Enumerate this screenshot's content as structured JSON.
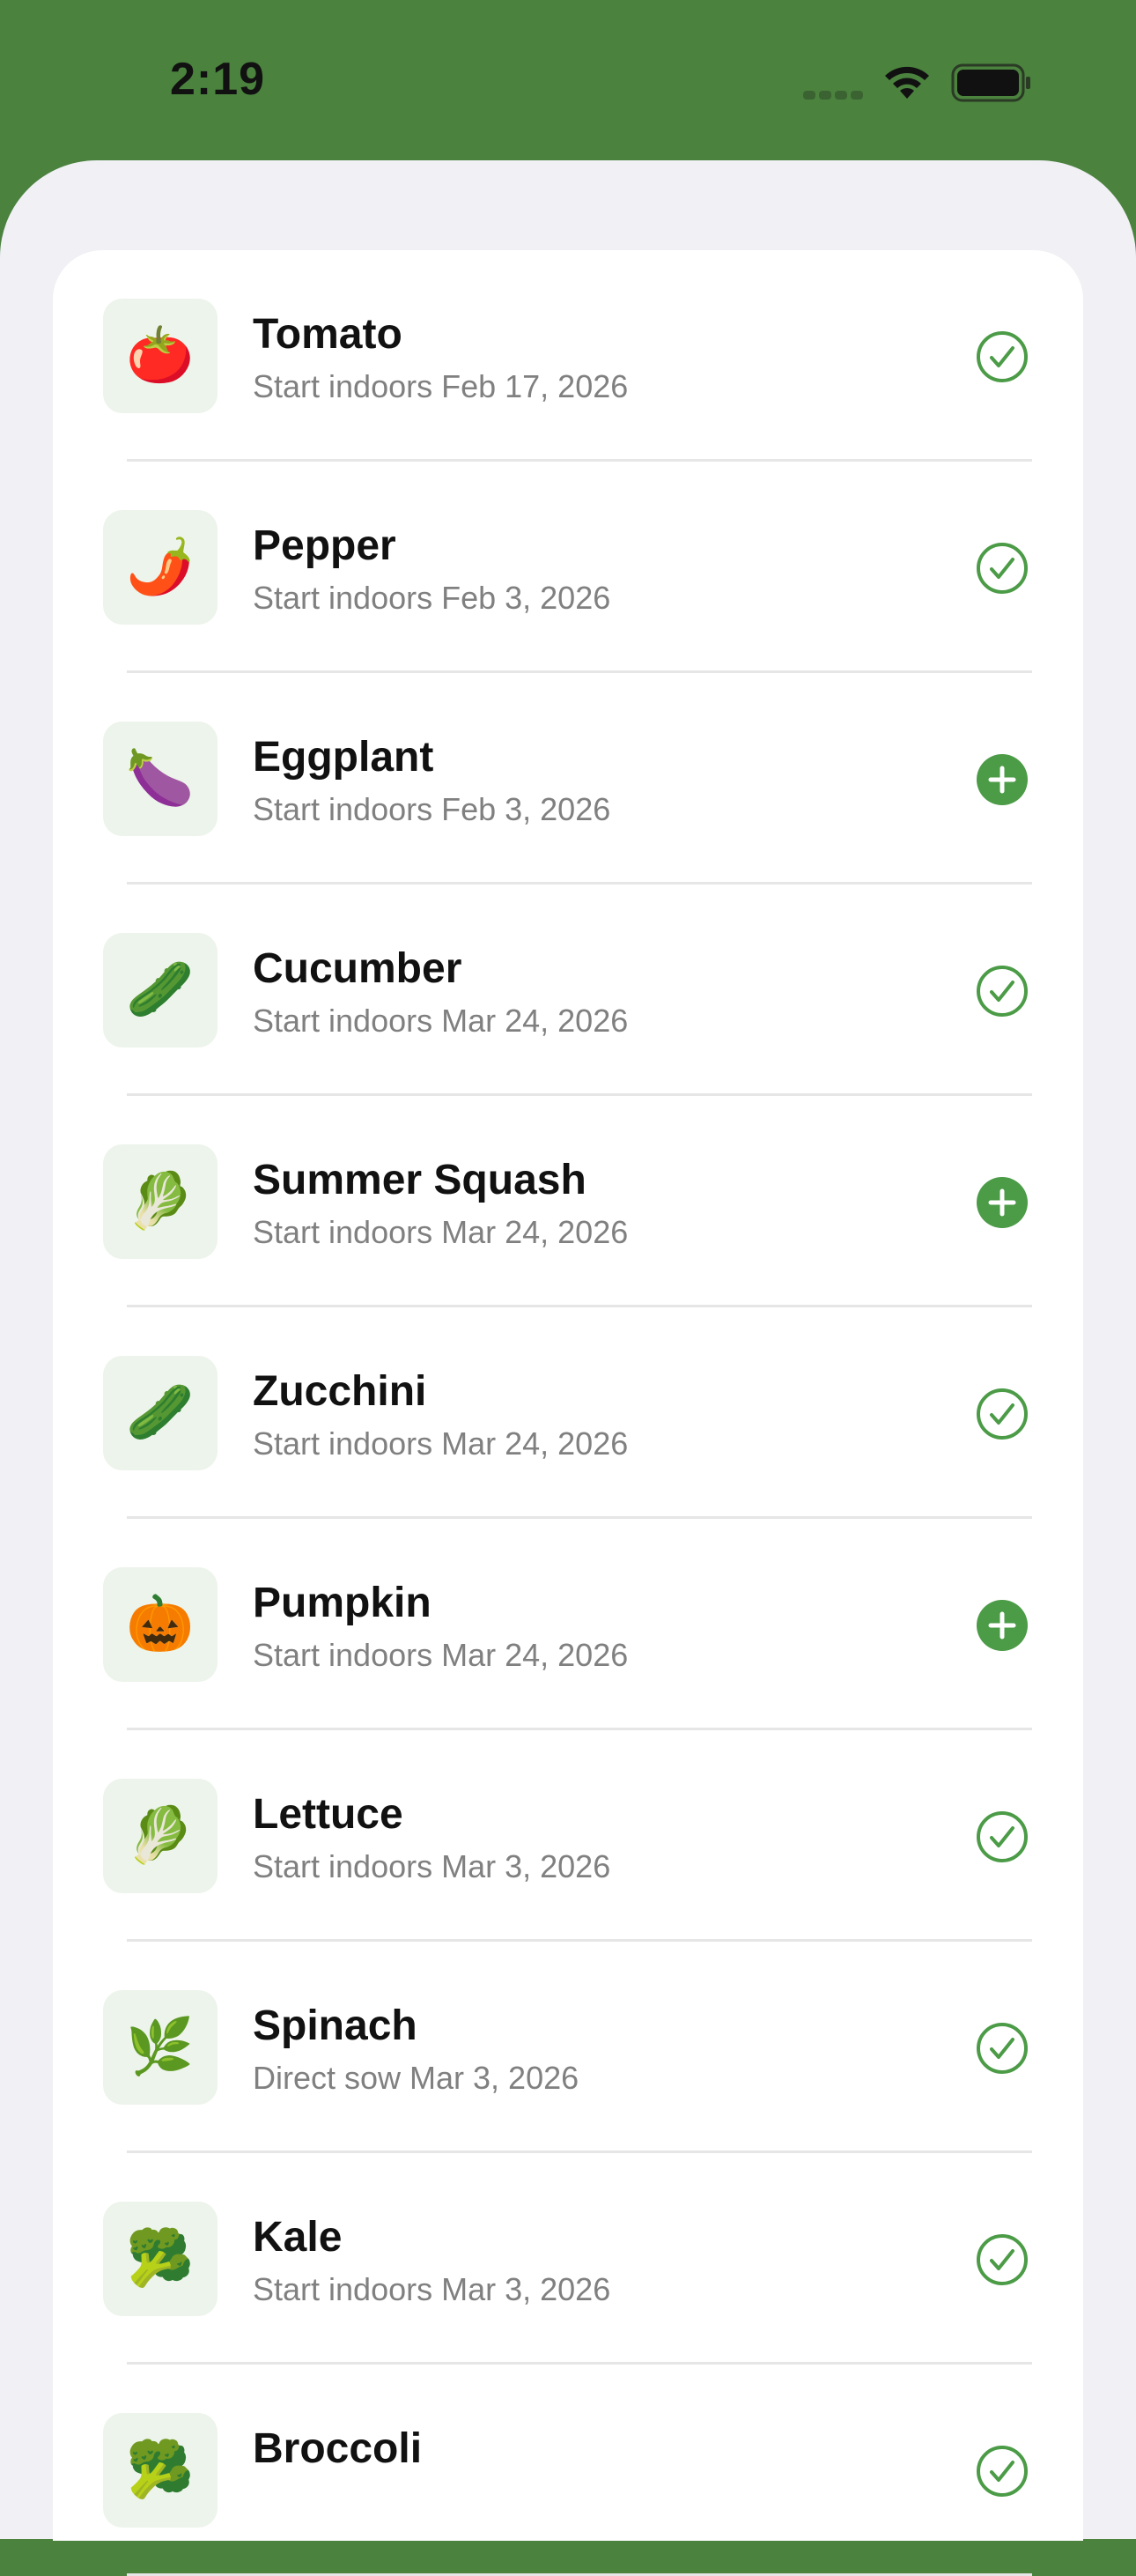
{
  "status_bar": {
    "time": "2:19"
  },
  "colors": {
    "header": "#4a823e",
    "accent": "#4b9b47",
    "sheet": "#f0f0f5",
    "tile": "#edf4eb"
  },
  "plants": [
    {
      "emoji": "🍅",
      "icon": "tomato-icon",
      "name": "Tomato",
      "subtitle": "Start indoors Feb 17, 2026",
      "status": "added"
    },
    {
      "emoji": "🌶️",
      "icon": "pepper-icon",
      "name": "Pepper",
      "subtitle": "Start indoors Feb 3, 2026",
      "status": "added"
    },
    {
      "emoji": "🍆",
      "icon": "eggplant-icon",
      "name": "Eggplant",
      "subtitle": "Start indoors Feb 3, 2026",
      "status": "add"
    },
    {
      "emoji": "🥒",
      "icon": "cucumber-icon",
      "name": "Cucumber",
      "subtitle": "Start indoors Mar 24, 2026",
      "status": "added"
    },
    {
      "emoji": "🥬",
      "icon": "leafy-greens-icon",
      "name": "Summer Squash",
      "subtitle": "Start indoors Mar 24, 2026",
      "status": "add"
    },
    {
      "emoji": "🥒",
      "icon": "cucumber-icon",
      "name": "Zucchini",
      "subtitle": "Start indoors Mar 24, 2026",
      "status": "added"
    },
    {
      "emoji": "🎃",
      "icon": "pumpkin-icon",
      "name": "Pumpkin",
      "subtitle": "Start indoors Mar 24, 2026",
      "status": "add"
    },
    {
      "emoji": "🥬",
      "icon": "leafy-greens-icon",
      "name": "Lettuce",
      "subtitle": "Start indoors Mar 3, 2026",
      "status": "added"
    },
    {
      "emoji": "🌿",
      "icon": "herb-icon",
      "name": "Spinach",
      "subtitle": "Direct sow Mar 3, 2026",
      "status": "added"
    },
    {
      "emoji": "🥦",
      "icon": "broccoli-icon",
      "name": "Kale",
      "subtitle": "Start indoors Mar 3, 2026",
      "status": "added"
    },
    {
      "emoji": "🥦",
      "icon": "broccoli-icon",
      "name": "Broccoli",
      "subtitle": "",
      "status": "added"
    }
  ]
}
